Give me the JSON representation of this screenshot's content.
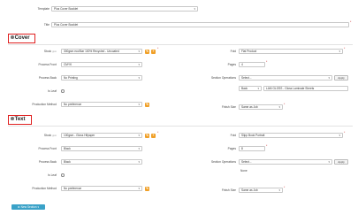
{
  "header": {
    "template_label": "Template",
    "template_value": "Plus Cover Booklet",
    "title_label": "Title",
    "title_value": "Plus Cover Booklet"
  },
  "sections": {
    "cover": {
      "title": "Cover",
      "stock_label": "Stock",
      "stock_sub": "gsm",
      "stock_value": "300gsm ecoStar 100% Recycled - Uncoated",
      "fold_label": "Fold",
      "fold_value": "Flat Product",
      "process_front_label": "Process Front",
      "process_front_value": "CMYK",
      "pages_label": "Pages",
      "pages_value": "4",
      "process_back_label": "Process Back",
      "process_back_value": "No Printing",
      "section_ops_label": "Section Operations",
      "section_ops_value": "Select...",
      "apply_label": "Apply",
      "is_leaf_label": "Is Leaf",
      "back_value": "Back",
      "lam_value": "LAM GLOSS - Gloss Laminate Sheets",
      "production_method_label": "Production Method",
      "production_method_value": "No preference",
      "finish_size_label": "Finish Size",
      "finish_size_value": "Same as Job"
    },
    "text": {
      "title": "Text",
      "stock_label": "Stock",
      "stock_sub": "gsm",
      "stock_value": "100gsm - Gloss Hifpaper",
      "fold_label": "Fold",
      "fold_value": "Slipp Book Portrait",
      "process_front_label": "Process Front",
      "process_front_value": "Black",
      "pages_label": "Pages",
      "pages_value": "8",
      "process_back_label": "Process Back",
      "process_back_value": "Black",
      "section_ops_label": "Section Operations",
      "section_ops_value": "Select...",
      "apply_label": "Apply",
      "none_value": "None",
      "is_leaf_label": "Is Leaf",
      "production_method_label": "Production Method",
      "production_method_value": "No preference",
      "finish_size_label": "Finish Size",
      "finish_size_value": "Same as Job"
    }
  },
  "footer": {
    "new_section_label": "New Section"
  },
  "icons": {
    "edit": "pencil-icon",
    "add": "plus-icon",
    "dropdown": "chevron-down-icon",
    "section": "gear-icon"
  },
  "colors": {
    "highlight_border": "#e02020",
    "icon_button": "#f0a028",
    "new_section_button": "#3aa2c8",
    "required": "#cc3333"
  }
}
